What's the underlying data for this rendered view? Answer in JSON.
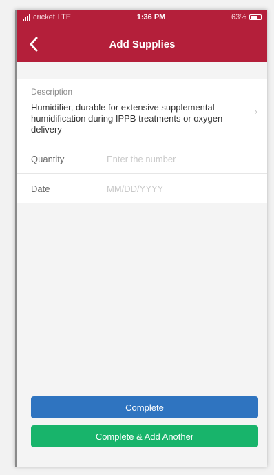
{
  "status_bar": {
    "carrier": "cricket",
    "network": "LTE",
    "time": "1:36 PM",
    "battery": "63%",
    "battery_level": 0.63
  },
  "nav": {
    "title": "Add Supplies",
    "back_icon": "chevron-left-icon"
  },
  "form": {
    "description": {
      "label": "Description",
      "value": "Humidifier, durable for extensive supplemental humidification during IPPB treatments or oxygen delivery",
      "icon": "chevron-right-icon"
    },
    "quantity": {
      "label": "Quantity",
      "value": "",
      "placeholder": "Enter the number"
    },
    "date": {
      "label": "Date",
      "value": "",
      "placeholder": "MM/DD/YYYY"
    }
  },
  "buttons": {
    "complete_label": "Complete",
    "complete_add_label": "Complete & Add Another"
  },
  "colors": {
    "header": "#b41f3a",
    "complete_button": "#2f74c0",
    "complete_add_button": "#18b46b"
  }
}
